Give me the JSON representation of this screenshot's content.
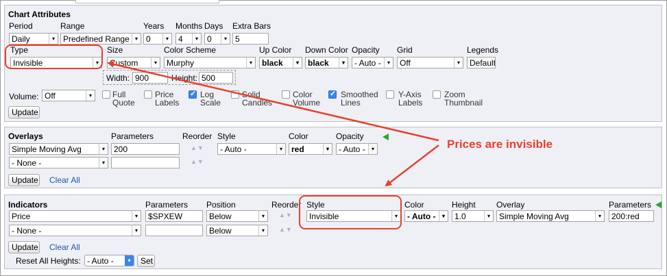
{
  "chart_attributes": {
    "title": "Chart Attributes",
    "labels": {
      "period": "Period",
      "range": "Range",
      "years": "Years",
      "months": "Months",
      "days": "Days",
      "extra_bars": "Extra Bars",
      "type": "Type",
      "size": "Size",
      "color_scheme": "Color Scheme",
      "up_color": "Up Color",
      "down_color": "Down Color",
      "opacity": "Opacity",
      "grid": "Grid",
      "legends": "Legends",
      "width": "Width:",
      "height": "Height:",
      "volume": "Volume:"
    },
    "values": {
      "period": "Daily",
      "range": "Predefined Range",
      "years": "0",
      "months": "4",
      "days": "0",
      "extra_bars": "5",
      "type": "Invisible",
      "size": "Custom",
      "color_scheme": "Murphy",
      "up_color": "black",
      "down_color": "black",
      "opacity": "- Auto -",
      "grid": "Off",
      "legends": "Default",
      "width": "900",
      "height": "500",
      "volume": "Off"
    },
    "checkboxes": [
      {
        "line1": "Full",
        "line2": "Quote",
        "checked": false
      },
      {
        "line1": "Price",
        "line2": "Labels",
        "checked": false
      },
      {
        "line1": "Log",
        "line2": "Scale",
        "checked": true
      },
      {
        "line1": "Solid",
        "line2": "Candles",
        "checked": false
      },
      {
        "line1": "Color",
        "line2": "Volume",
        "checked": false
      },
      {
        "line1": "Smoothed",
        "line2": "Lines",
        "checked": true
      },
      {
        "line1": "Y-Axis",
        "line2": "Labels",
        "checked": false
      },
      {
        "line1": "Zoom",
        "line2": "Thumbnail",
        "checked": false
      }
    ],
    "update_label": "Update"
  },
  "overlays": {
    "title": "Overlays",
    "labels": {
      "parameters": "Parameters",
      "reorder": "Reorder",
      "style": "Style",
      "color": "Color",
      "opacity": "Opacity"
    },
    "rows": [
      {
        "name": "Simple Moving Avg",
        "parameters": "200",
        "style": "- Auto -",
        "color": "red",
        "opacity": "- Auto -"
      },
      {
        "name": "- None -",
        "parameters": ""
      }
    ],
    "update_label": "Update",
    "clear_label": "Clear All"
  },
  "indicators": {
    "title": "Indicators",
    "labels": {
      "parameters": "Parameters",
      "position": "Position",
      "reorder": "Reorder",
      "style": "Style",
      "color": "Color",
      "height": "Height",
      "overlay": "Overlay",
      "parameters2": "Parameters"
    },
    "rows": [
      {
        "name": "Price",
        "parameters": "$SPXEW",
        "position": "Below",
        "style": "Invisible",
        "color": "- Auto -",
        "height": "1.0",
        "overlay": "Simple Moving Avg",
        "overlay_params": "200:red"
      },
      {
        "name": "- None -",
        "parameters": "",
        "position": "Below"
      }
    ],
    "update_label": "Update",
    "clear_label": "Clear All",
    "reset_heights_label": "Reset All Heights:",
    "reset_heights_value": "- Auto -",
    "set_label": "Set"
  },
  "annotation": {
    "text": "Prices are invisible",
    "color": "#e8412c"
  },
  "icons": {
    "select_arrow": "▾",
    "reorder_arrows": "▲▼",
    "add_icon": "green-triangle"
  }
}
